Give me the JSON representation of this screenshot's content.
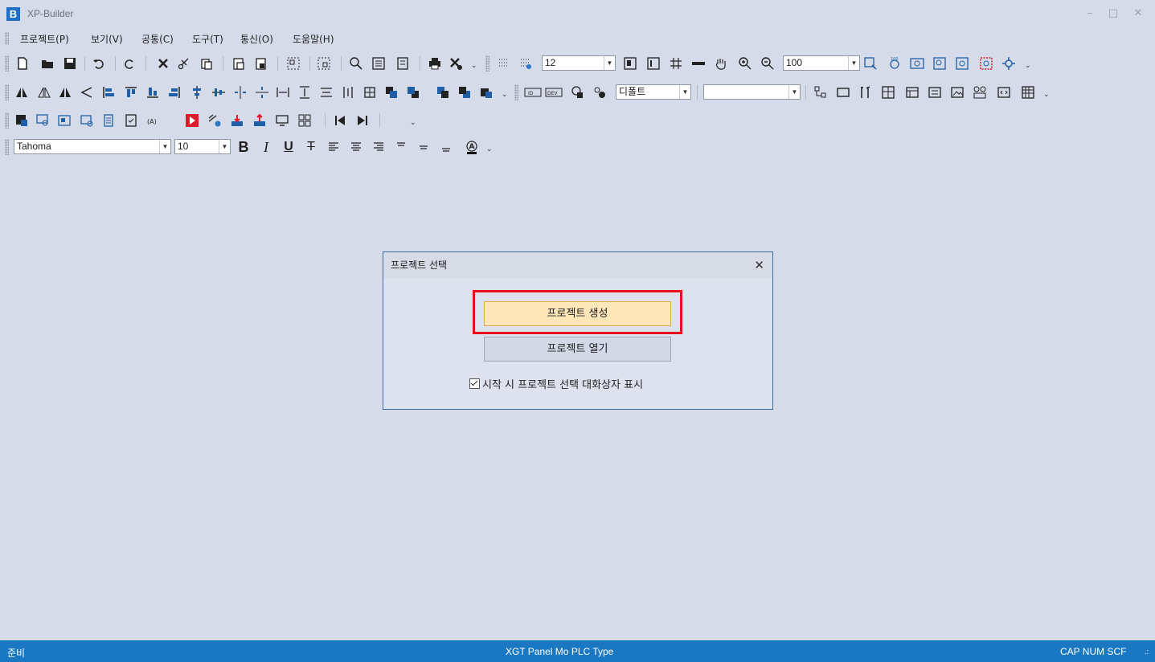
{
  "window": {
    "logo": "B",
    "title": "XP-Builder",
    "controls": [
      "–",
      "□",
      "✕"
    ]
  },
  "menu": [
    "프로젝트(P)",
    "보기(V)",
    "공통(C)",
    "도구(T)",
    "통신(O)",
    "도움말(H)"
  ],
  "toolbar1": {
    "grid_size": "12",
    "zoom": "100"
  },
  "toolbar2": {
    "language": "디폴트",
    "second_combo": ""
  },
  "font_toolbar": {
    "font_name": "Tahoma",
    "font_size": "10",
    "bold": "B",
    "italic": "I",
    "underline": "U",
    "strike": "T"
  },
  "dialog": {
    "title": "프로젝트 선택",
    "close": "✕",
    "create_button": "프로젝트 생성",
    "open_button": "프로젝트 열기",
    "checkbox_label": "시작 시 프로젝트 선택 대화상자 표시",
    "checkbox_checked": true
  },
  "status": {
    "left": "준비",
    "center": "XGT Panel Mo  PLC Type",
    "right": "CAP  NUM  SCF"
  },
  "colors": {
    "statusbar": "#1a78c2",
    "highlight": "#e8101a",
    "primary_button": "#fde6b7"
  }
}
